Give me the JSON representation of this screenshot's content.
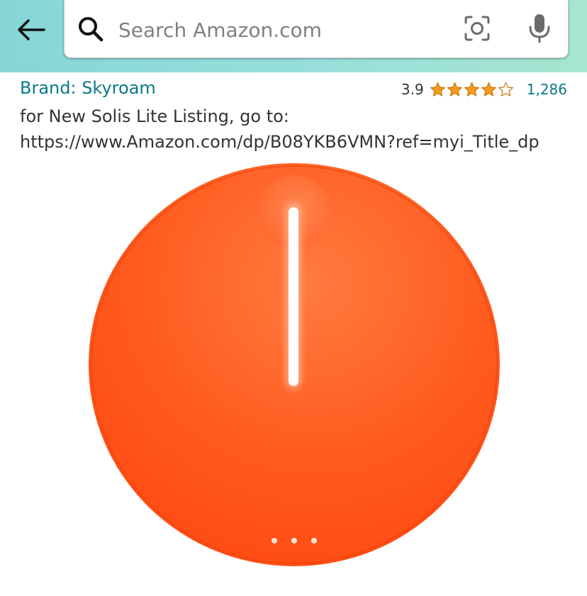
{
  "header": {
    "search_placeholder": "Search Amazon.com",
    "icons": {
      "back": "back-arrow-icon",
      "search": "search-icon",
      "camera": "camera-lens-icon",
      "mic": "microphone-icon"
    },
    "colors": {
      "bar_start": "#86d6d8",
      "bar_end": "#a6e6d0"
    }
  },
  "product": {
    "brand_link": "Brand: Skyroam",
    "rating_value": "3.9",
    "rating_stars": 3.9,
    "rating_max": 5,
    "rating_count": "1,286",
    "description_line1": "for New Solis Lite Listing, go to:",
    "description_line2": "https://www.Amazon.com/dp/B08YKB6VMN?ref=myi_Title_dp",
    "image": {
      "subject": "orange round hotspot device with white light bar",
      "body_color": "#ff5a1f",
      "carousel_dots": 3
    },
    "colors": {
      "link": "#0a7a86",
      "star": "#f39b1c"
    }
  }
}
